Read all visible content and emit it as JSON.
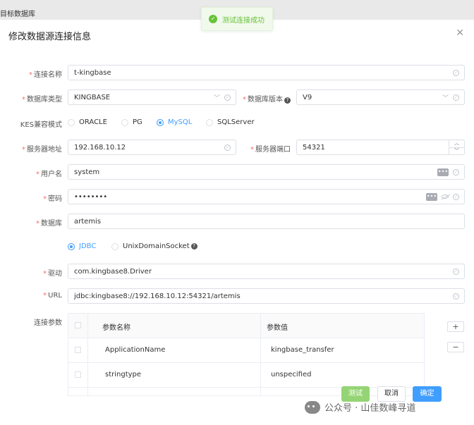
{
  "topbar": {
    "text": "目标数据库"
  },
  "dialog": {
    "title": "修改数据源连接信息",
    "close_icon": "close-icon"
  },
  "toast": {
    "message": "测试连接成功",
    "icon": "check-circle-icon",
    "color": "#67c23a"
  },
  "form": {
    "conn_name": {
      "label": "连接名称",
      "value": "t-kingbase"
    },
    "db_type": {
      "label": "数据库类型",
      "value": "KINGBASE"
    },
    "db_version": {
      "label": "数据库版本",
      "value": "V9"
    },
    "kes_mode": {
      "label": "KES兼容模式",
      "options": [
        "ORACLE",
        "PG",
        "MySQL",
        "SQLServer"
      ],
      "selected": "MySQL"
    },
    "server_addr": {
      "label": "服务器地址",
      "value": "192.168.10.12"
    },
    "server_port": {
      "label": "服务器端口",
      "value": "54321"
    },
    "username": {
      "label": "用户名",
      "value": "system"
    },
    "password": {
      "label": "密码",
      "value": "••••••••"
    },
    "database": {
      "label": "数据库",
      "value": "artemis"
    },
    "conn_mode": {
      "options": [
        "JDBC",
        "UnixDomainSocket"
      ],
      "selected": "JDBC"
    },
    "driver": {
      "label": "驱动",
      "value": "com.kingbase8.Driver"
    },
    "url": {
      "label": "URL",
      "value": "jdbc:kingbase8://192.168.10.12:54321/artemis"
    }
  },
  "params": {
    "label": "连接参数",
    "headers": [
      "参数名称",
      "参数值"
    ],
    "rows": [
      {
        "name": "ApplicationName",
        "value": "kingbase_transfer"
      },
      {
        "name": "stringtype",
        "value": "unspecified"
      }
    ],
    "add_label": "+",
    "remove_label": "−"
  },
  "buttons": {
    "test": "测试",
    "cancel": "取消",
    "ok": "确定"
  },
  "colors": {
    "primary": "#409eff",
    "success": "#67c23a",
    "danger": "#f56c6c"
  },
  "watermark": {
    "text": "公众号 · 山佳数峰寻道"
  }
}
